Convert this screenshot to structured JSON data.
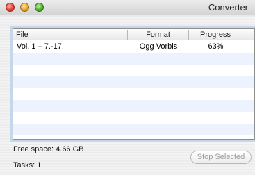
{
  "window": {
    "title": "Converter"
  },
  "table": {
    "columns": [
      "File",
      "Format",
      "Progress"
    ],
    "rows": [
      {
        "file": "Vol. 1 – 7.-17.",
        "format": "Ogg Vorbis",
        "progress": "63%"
      }
    ]
  },
  "status": {
    "free_space": "Free space: 4.66 GB",
    "tasks": "Tasks: 1"
  },
  "buttons": {
    "stop_selected": "Stop Selected"
  }
}
